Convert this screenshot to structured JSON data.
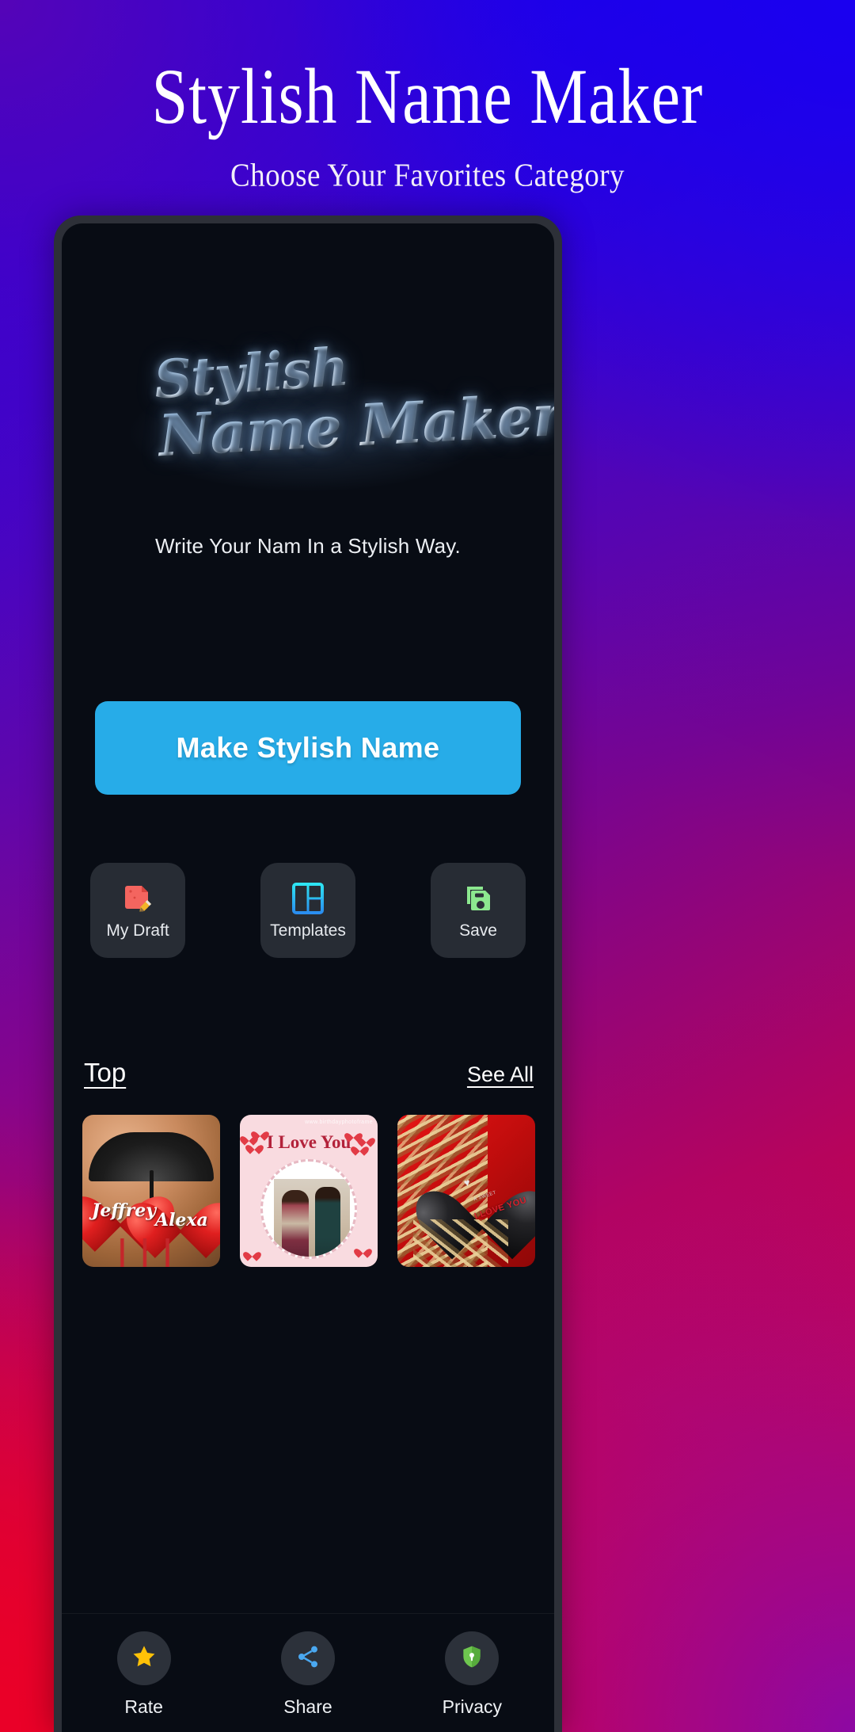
{
  "header": {
    "title": "Stylish Name Maker",
    "subtitle": "Choose Your Favorites Category"
  },
  "app": {
    "logo_line1": "Stylish",
    "logo_line2": "Name Maker",
    "tagline": "Write Your Nam In a Stylish Way.",
    "cta_label": "Make Stylish Name"
  },
  "tiles": [
    {
      "label": "My Draft",
      "icon": "document-pencil-icon",
      "color": "#f4655f"
    },
    {
      "label": "Templates",
      "icon": "layout-grid-icon",
      "color": "#29c4f0"
    },
    {
      "label": "Save",
      "icon": "floppy-disk-icon",
      "color": "#8ce88f"
    }
  ],
  "section": {
    "title": "Top",
    "see_all": "See All"
  },
  "cards": [
    {
      "name": "umbrella-hearts-card",
      "name1": "Jeffrey",
      "name2": "Alexa"
    },
    {
      "name": "i-love-you-couple-card",
      "title": "I Love You",
      "watermark": "www.birthdayphotoframe"
    },
    {
      "name": "heart-locket-card",
      "engraved_small": "A SWEET",
      "engraved_main": "I LOVE YOU",
      "birds": "♥"
    }
  ],
  "bottom_nav": [
    {
      "label": "Rate",
      "icon": "star-icon",
      "color": "#ffc107"
    },
    {
      "label": "Share",
      "icon": "share-icon",
      "color": "#4aa8f0"
    },
    {
      "label": "Privacy",
      "icon": "shield-lock-icon",
      "color": "#6ec64f"
    }
  ],
  "colors": {
    "accent_blue": "#27ace8",
    "screen_bg": "#080c14",
    "tile_bg": "#272c34",
    "frame": "#2d3038"
  }
}
